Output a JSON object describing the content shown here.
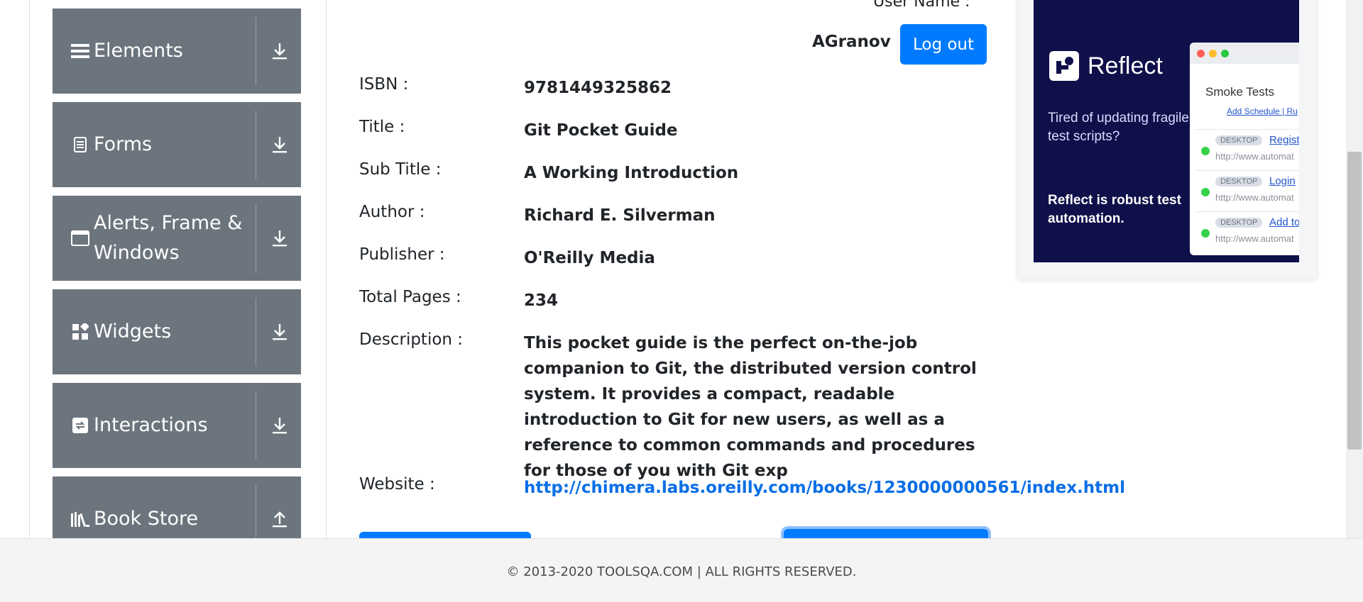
{
  "sidebar": {
    "groups": [
      {
        "label": "Elements",
        "icon": "menu-icon",
        "arrow": "download-arrow-icon"
      },
      {
        "label": "Forms",
        "icon": "document-icon",
        "arrow": "download-arrow-icon"
      },
      {
        "label": "Alerts, Frame & Windows",
        "icon": "window-icon",
        "arrow": "download-arrow-icon"
      },
      {
        "label": "Widgets",
        "icon": "widgets-icon",
        "arrow": "download-arrow-icon"
      },
      {
        "label": "Interactions",
        "icon": "interactions-icon",
        "arrow": "download-arrow-icon"
      },
      {
        "label": "Book Store",
        "icon": "books-icon",
        "arrow": "upload-arrow-icon"
      }
    ]
  },
  "user": {
    "label": "User Name :",
    "name": "AGranov",
    "logout_label": "Log out"
  },
  "book": {
    "isbn_label": "ISBN :",
    "isbn": "9781449325862",
    "title_label": "Title :",
    "title": "Git Pocket Guide",
    "subtitle_label": "Sub Title :",
    "subtitle": "A Working Introduction",
    "author_label": "Author :",
    "author": "Richard E. Silverman",
    "publisher_label": "Publisher :",
    "publisher": "O'Reilly Media",
    "pages_label": "Total Pages :",
    "pages": "234",
    "description_label": "Description :",
    "description": "This pocket guide is the perfect on-the-job companion to Git, the distributed version control system. It provides a compact, readable introduction to Git for new users, as well as a reference to common commands and procedures for those of you with Git exp",
    "website_label": "Website :",
    "website": "http://chimera.labs.oreilly.com/books/1230000000561/index.html"
  },
  "ad": {
    "brand": "Reflect",
    "tagline": "Tired of updating fragile test scripts?",
    "headline": "Reflect is robust test automation.",
    "window_title": "Smoke Tests",
    "schedule_link": "Add Schedule",
    "schedule_link_2": "Ru",
    "items": [
      {
        "tag": "DESKTOP",
        "name": "Registr",
        "url": "http://www.automat"
      },
      {
        "tag": "DESKTOP",
        "name": "Login",
        "url": "http://www.automat"
      },
      {
        "tag": "DESKTOP",
        "name": "Add to",
        "url": "http://www.automat"
      }
    ]
  },
  "footer": {
    "text": "© 2013-2020 TOOLSQA.COM | ALL RIGHTS RESERVED."
  },
  "colors": {
    "primary": "#007bff",
    "sidebar_bg": "#6c757d",
    "ad_bg": "#0f0f4a"
  }
}
